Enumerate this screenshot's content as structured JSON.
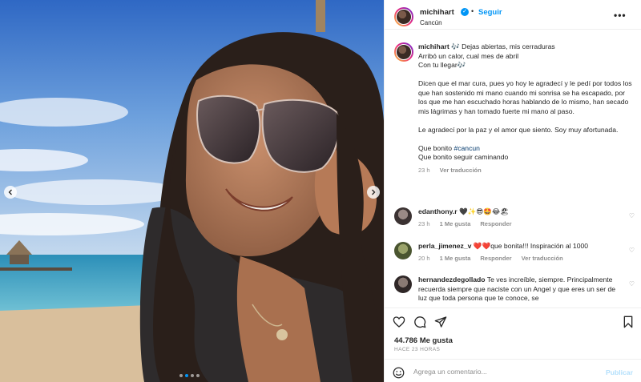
{
  "post": {
    "username": "michihart",
    "follow_label": "Seguir",
    "location": "Cancún",
    "more_label": "•••"
  },
  "caption": {
    "username": "michihart",
    "lines": [
      "🎶 Dejas abiertas, mis cerraduras",
      "Arribó un calor, cual mes de abril",
      "Con tu llegar🎶",
      "Dicen que el mar cura, pues yo hoy le agradecí y le pedí por todos los que han sostenido mi mano cuando mi sonrisa se ha escapado, por los que me han escuchado horas hablando de lo mismo, han secado mis lágrimas y han tomado fuerte mi mano al paso.",
      "Le agradecí por la paz y el amor que siento. Soy muy afortunada.",
      "Que bonito ",
      "#cancun",
      "Que bonito seguir caminando"
    ],
    "time": "23 h",
    "translate_label": "Ver traducción"
  },
  "comments": [
    {
      "username": "edanthony.r",
      "text": "🖤✨😎🤩😂🏖",
      "time": "23 h",
      "likes": "1 Me gusta",
      "reply": "Responder",
      "translate": ""
    },
    {
      "username": "perla_jimenez_v",
      "text": "❤️❤️que bonita!!! Inspiración al 1000",
      "time": "20 h",
      "likes": "1 Me gusta",
      "reply": "Responder",
      "translate": "Ver traducción"
    },
    {
      "username": "hernandezdegollado",
      "text": "Te ves increíble, siempre. Principalmente recuerda siempre que naciste con un Angel y que eres un ser de luz que toda persona que te conoce, se",
      "time": "",
      "likes": "",
      "reply": "",
      "translate": ""
    }
  ],
  "stats": {
    "likes": "44.786 Me gusta",
    "ago": "HACE 23 HORAS"
  },
  "composer": {
    "placeholder": "Agrega un comentario...",
    "publish_label": "Publicar"
  },
  "carousel": {
    "slide_count": 4,
    "active_index": 1
  },
  "colors": {
    "accent": "#0095f6",
    "muted": "#8e8e8e",
    "publish_disabled": "#b2dffc",
    "hashtag": "#00376b"
  },
  "icons": [
    "chevron-left-icon",
    "chevron-right-icon",
    "verified-badge-icon",
    "more-icon",
    "heart-icon",
    "comment-icon",
    "share-icon",
    "bookmark-icon",
    "emoji-icon"
  ]
}
